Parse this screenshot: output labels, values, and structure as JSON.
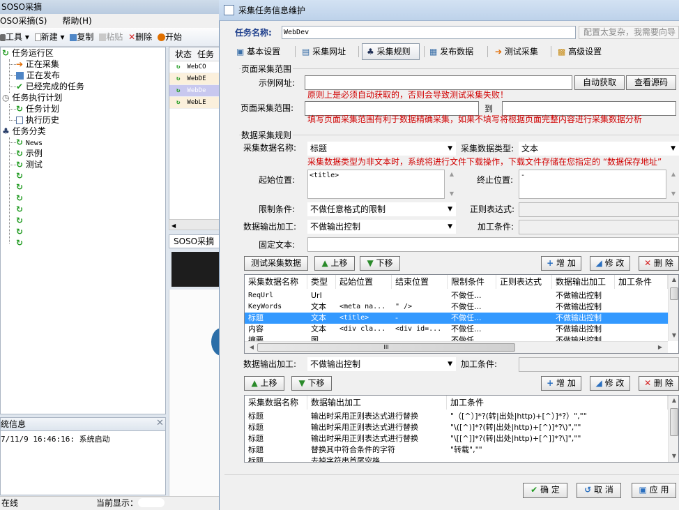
{
  "main_window": {
    "title": "SOSO采摘",
    "menu": [
      "OSO采摘(S)",
      "帮助(H)"
    ],
    "toolbar": {
      "tools": "工具",
      "new": "新建",
      "copy": "复制",
      "paste": "粘贴",
      "delete": "删除",
      "start": "开始"
    },
    "tree": {
      "run_area": "任务运行区",
      "collecting": "正在采集",
      "publishing": "正在发布",
      "completed": "已经完成的任务",
      "plan": "任务执行计划",
      "task_plan": "任务计划",
      "history": "执行历史",
      "category": "任务分类",
      "items": [
        "News",
        "示例",
        "测试"
      ]
    },
    "list": {
      "col_status": "状态",
      "col_task": "任务",
      "rows": [
        "WebCO",
        "WebDE",
        "WebDe",
        "WebLE"
      ]
    },
    "tab2": "SOSO采摘",
    "log": {
      "title": "统信息",
      "line": "7/11/9 16:46:16: 系统启动"
    },
    "status": {
      "online": "在线",
      "current": "当前显示："
    }
  },
  "dialog": {
    "title": "采集任务信息维护",
    "task_name_label": "任务名称:",
    "task_name_value": "WebDev",
    "task_hint": "配置太复杂，我需要向导",
    "tabs": [
      "基本设置",
      "采集网址",
      "采集规则",
      "发布数据",
      "测试采集",
      "高级设置"
    ],
    "active_tab": "采集规则",
    "page_range": {
      "group_title": "页面采集范围",
      "sample_url_label": "示例网址:",
      "auto_get": "自动获取",
      "view_source": "查看源码",
      "warn1": "原则上是必须自动获取的，否则会导致测试采集失败！",
      "range_label": "页面采集范围:",
      "to": "到",
      "warn2": "填写页面采集范围有利于数据精确采集，如果不填写将根据页面完整内容进行采集数据分析"
    },
    "rules": {
      "group_title": "数据采集规则",
      "name_label": "采集数据名称:",
      "name_value": "标题",
      "type_label": "采集数据类型:",
      "type_value": "文本",
      "warn3": "采集数据类型为非文本时，系统将进行文件下载操作，下载文件存储在您指定的 “数据保存地址”",
      "start_label": "起始位置:",
      "start_value": "<title>",
      "end_label": "终止位置:",
      "end_value": "-",
      "limit_label": "限制条件:",
      "limit_value": "不做任意格式的限制",
      "regex_label": "正则表达式:",
      "output_label": "数据输出加工:",
      "output_value": "不做输出控制",
      "cond_label": "加工条件:",
      "fixed_label": "固定文本:",
      "test_btn": "测试采集数据",
      "up_btn": "上移",
      "down_btn": "下移",
      "add_btn": "增 加",
      "edit_btn": "修 改",
      "del_btn": "删 除"
    },
    "grid1": {
      "headers": [
        "采集数据名称",
        "类型",
        "起始位置",
        "结束位置",
        "限制条件",
        "正则表达式",
        "数据输出加工",
        "加工条件"
      ],
      "rows": [
        [
          "ReqUrl",
          "Url",
          "",
          "",
          "不做任...",
          "",
          "不做输出控制",
          ""
        ],
        [
          "KeyWords",
          "文本",
          "<meta na...",
          "\" />",
          "不做任...",
          "",
          "不做输出控制",
          ""
        ],
        [
          "标题",
          "文本",
          "<title>",
          "-",
          "不做任...",
          "",
          "不做输出控制",
          ""
        ],
        [
          "内容",
          "文本",
          "<div cla...",
          "<div id=...",
          "不做任...",
          "",
          "不做输出控制",
          ""
        ],
        [
          "摘要",
          "图",
          "",
          "",
          "不做任...",
          "",
          "不做输出控制",
          ""
        ]
      ],
      "selected_row": 2,
      "hscroll_label": "III"
    },
    "output": {
      "label": "数据输出加工:",
      "value": "不做输出控制",
      "cond_label": "加工条件:"
    },
    "grid2": {
      "headers": [
        "采集数据名称",
        "数据输出加工",
        "加工条件"
      ],
      "rows": [
        [
          "标题",
          "输出时采用正则表达式进行替换",
          "\"（[^）]*?(转|出处|http)+[^）]*?）\",\"\""
        ],
        [
          "标题",
          "输出时采用正则表达式进行替换",
          "\"\\([^)]*?(转|出处|http)+[^)]*?\\)\",\"\""
        ],
        [
          "标题",
          "输出时采用正则表达式进行替换",
          "\"\\[[^]]*?(转|出处|http)+[^]]*?\\]\",\"\""
        ],
        [
          "标题",
          "替换其中符合条件的字符",
          "\"转载\",\"\""
        ],
        [
          "标题",
          "去掉字符串首尾空格",
          ""
        ]
      ]
    },
    "footer": {
      "ok": "确 定",
      "cancel": "取 消",
      "apply": "应 用"
    }
  }
}
